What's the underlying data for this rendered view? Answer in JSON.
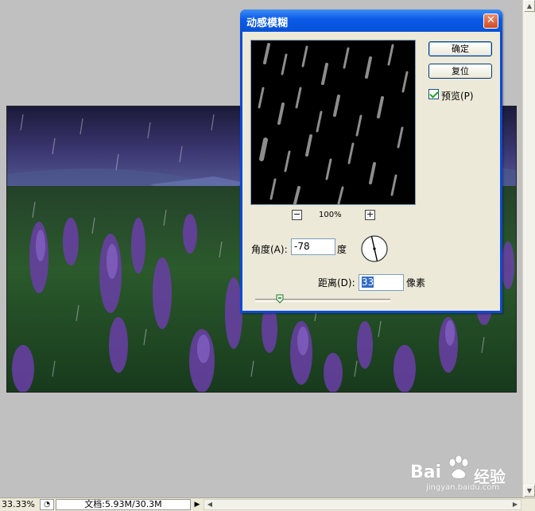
{
  "dialog": {
    "title": "动感模糊",
    "ok_label": "确定",
    "reset_label": "复位",
    "preview_label": "预览(P)",
    "preview_checked": true,
    "zoom_minus": "−",
    "zoom_plus": "+",
    "zoom_level": "100%",
    "angle_label": "角度(A):",
    "angle_value": "-78",
    "angle_unit": "度",
    "distance_label": "距离(D):",
    "distance_value": "33",
    "distance_unit": "像素"
  },
  "statusbar": {
    "zoom": "33.33%",
    "doc_info": "文档:5.93M/30.3M"
  },
  "watermark": {
    "brand": "Bai",
    "brand_cn": "经验",
    "url": "jingyan.baidu.com"
  },
  "colors": {
    "titlebar": "#0a5ae8",
    "dialog_face": "#ece9d8",
    "workspace": "#c0c0c0"
  }
}
